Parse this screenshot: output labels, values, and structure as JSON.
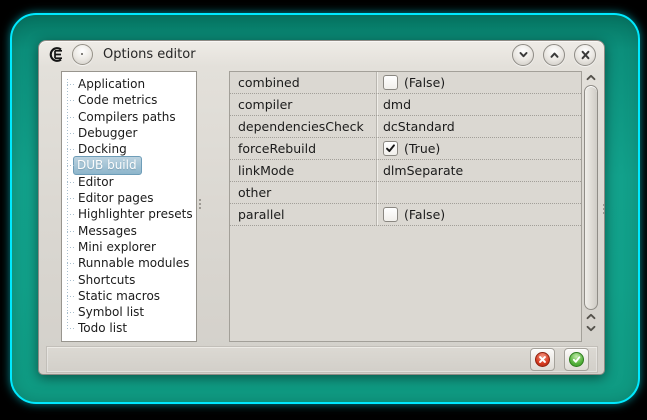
{
  "colors": {
    "desktop_teal": "#12a18b",
    "glow_cyan": "#00e9ff",
    "window_bg": "#dad7d1",
    "tree_bg": "#ffffff",
    "selection_fill": "#8db5cb",
    "selection_border": "#6e9db8",
    "grid_bg": "#dbd8d2",
    "text": "#1b1b1b",
    "cancel_red": "#d73c22",
    "accept_green": "#54b23c"
  },
  "titlebar": {
    "title": "Options editor",
    "app_icon": "coedit-logo-icon",
    "menu_button_icon": "window-menu-dot-icon",
    "buttons": [
      {
        "name": "minimize",
        "icon": "chevron-down-icon"
      },
      {
        "name": "maximize",
        "icon": "chevron-up-icon"
      },
      {
        "name": "close",
        "icon": "close-x-icon"
      }
    ]
  },
  "sidebar": {
    "items": [
      {
        "label": "Application",
        "selected": false
      },
      {
        "label": "Code metrics",
        "selected": false
      },
      {
        "label": "Compilers paths",
        "selected": false
      },
      {
        "label": "Debugger",
        "selected": false
      },
      {
        "label": "Docking",
        "selected": false
      },
      {
        "label": "DUB build",
        "selected": true
      },
      {
        "label": "Editor",
        "selected": false
      },
      {
        "label": "Editor pages",
        "selected": false
      },
      {
        "label": "Highlighter presets",
        "selected": false
      },
      {
        "label": "Messages",
        "selected": false
      },
      {
        "label": "Mini explorer",
        "selected": false
      },
      {
        "label": "Runnable modules",
        "selected": false
      },
      {
        "label": "Shortcuts",
        "selected": false
      },
      {
        "label": "Static macros",
        "selected": false
      },
      {
        "label": "Symbol list",
        "selected": false
      },
      {
        "label": "Todo list",
        "selected": false
      }
    ]
  },
  "property_grid": {
    "rows": [
      {
        "name": "combined",
        "type": "bool",
        "checked": false,
        "value": "(False)"
      },
      {
        "name": "compiler",
        "type": "text",
        "value": "dmd"
      },
      {
        "name": "dependenciesCheck",
        "type": "text",
        "value": "dcStandard"
      },
      {
        "name": "forceRebuild",
        "type": "bool",
        "checked": true,
        "value": "(True)"
      },
      {
        "name": "linkMode",
        "type": "text",
        "value": "dlmSeparate"
      },
      {
        "name": "other",
        "type": "text",
        "value": ""
      },
      {
        "name": "parallel",
        "type": "bool",
        "checked": false,
        "value": "(False)"
      }
    ]
  },
  "scrollbar": {
    "icons": [
      "chevron-up-icon",
      "chevron-up-icon",
      "chevron-down-icon"
    ]
  },
  "footer": {
    "buttons": [
      {
        "name": "cancel",
        "icon": "cancel-x-icon"
      },
      {
        "name": "accept",
        "icon": "accept-check-icon"
      }
    ]
  }
}
